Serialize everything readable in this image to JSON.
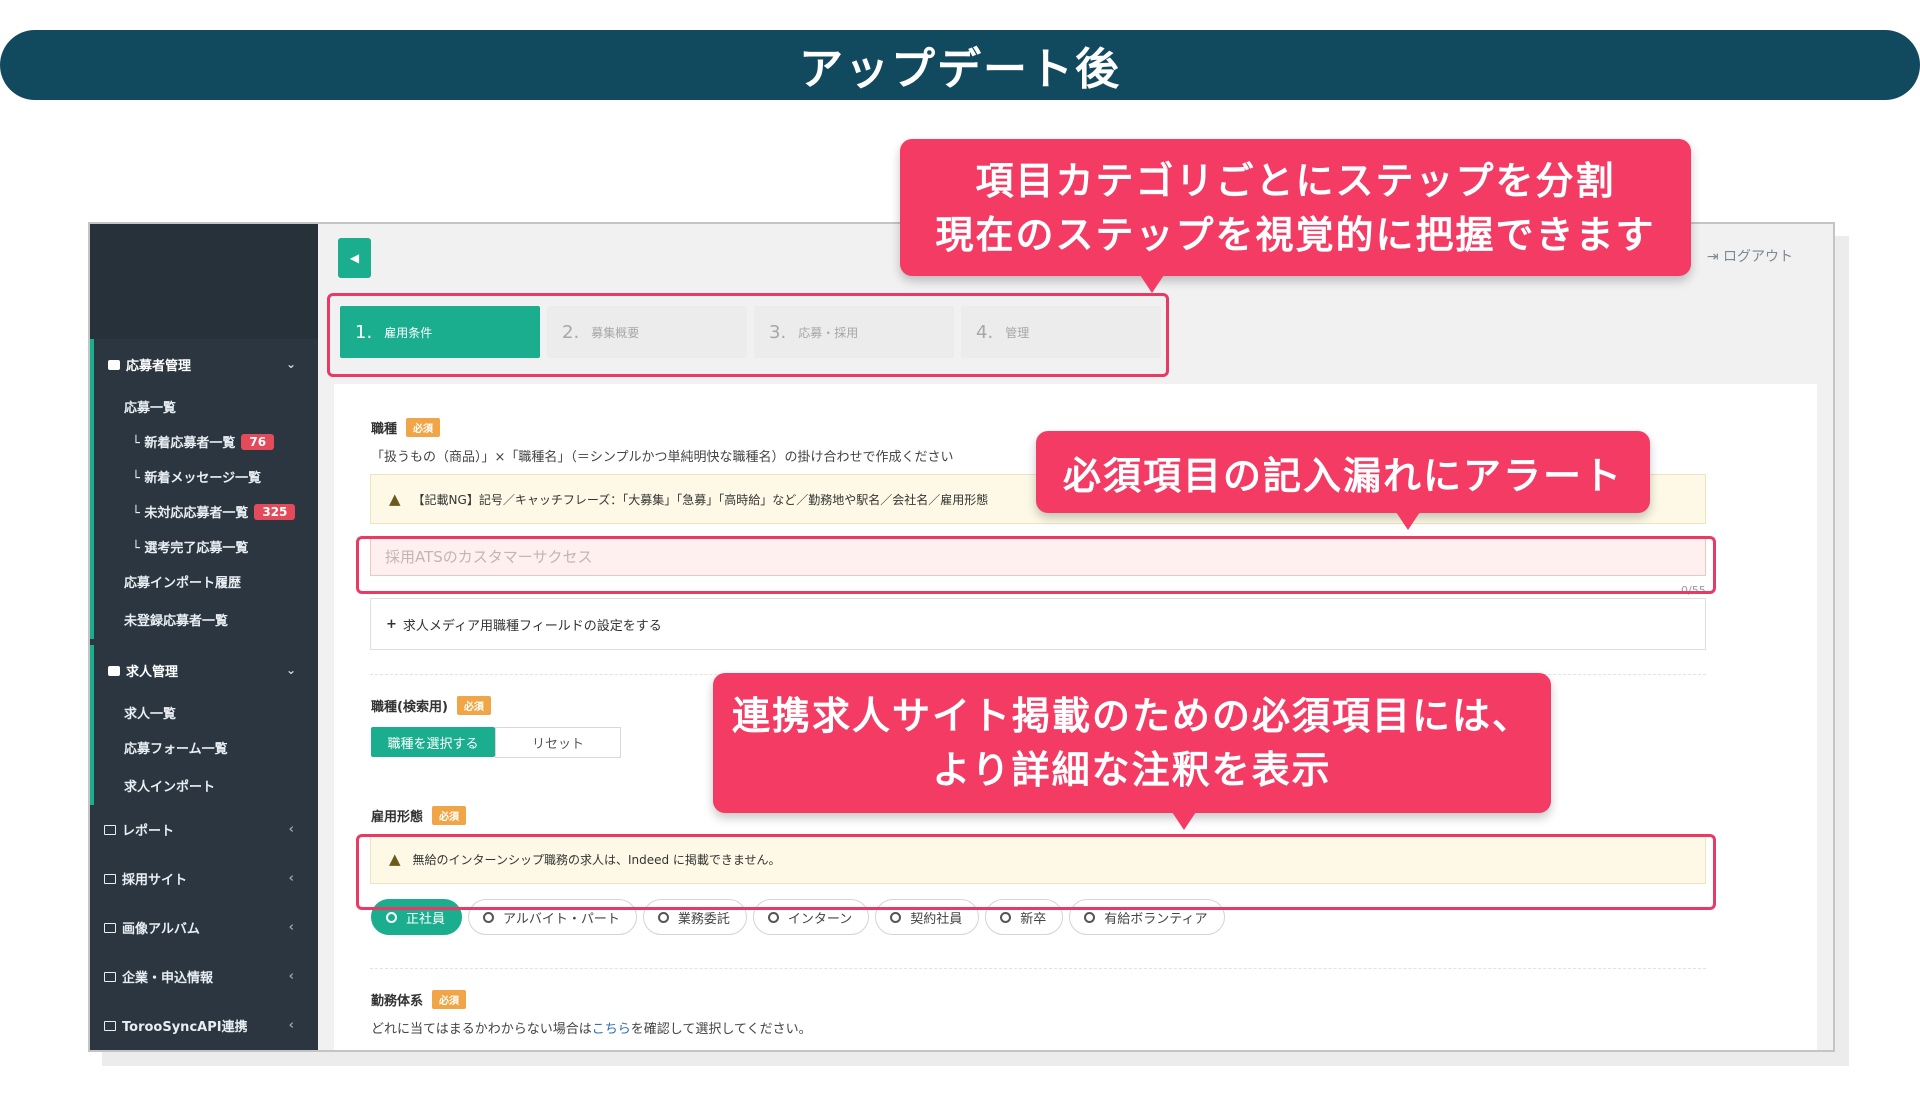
{
  "banner": {
    "title": "アップデート後"
  },
  "sidebar": {
    "group1": {
      "title": "応募者管理",
      "items": [
        {
          "label": "応募一覧",
          "badge": ""
        },
        {
          "label": "└ 新着応募者一覧",
          "badge": "76"
        },
        {
          "label": "└ 新着メッセージ一覧",
          "badge": ""
        },
        {
          "label": "└ 未対応応募者一覧",
          "badge": "325"
        },
        {
          "label": "└ 選考完了応募一覧",
          "badge": ""
        },
        {
          "label": "応募インポート履歴",
          "badge": ""
        },
        {
          "label": "未登録応募者一覧",
          "badge": ""
        }
      ]
    },
    "group2": {
      "title": "求人管理",
      "items": [
        {
          "label": "求人一覧"
        },
        {
          "label": "応募フォーム一覧"
        },
        {
          "label": "求人インポート"
        }
      ]
    },
    "links": [
      {
        "label": "レポート"
      },
      {
        "label": "採用サイト"
      },
      {
        "label": "画像アルバム"
      },
      {
        "label": "企業・申込情報"
      },
      {
        "label": "TorooSyncAPI連携"
      }
    ]
  },
  "header": {
    "logout": "ログアウト"
  },
  "steps": [
    {
      "num": "1.",
      "label": "雇用条件"
    },
    {
      "num": "2.",
      "label": "募集概要"
    },
    {
      "num": "3.",
      "label": "応募・採用"
    },
    {
      "num": "4.",
      "label": "管理"
    }
  ],
  "form": {
    "required_tag": "必須",
    "job_type": {
      "label": "職種",
      "help": "「扱うもの（商品）」×「職種名」（＝シンプルかつ単純明快な職種名）の掛け合わせで作成ください",
      "warning": "【記載NG】記号／キャッチフレーズ：「大募集」「急募」「高時給」など／勤務地や駅名／会社名／雇用形態",
      "placeholder": "採用ATSのカスタマーサクセス",
      "counter": "0/55",
      "media_field": "求人メディア用職種フィールドの設定をする"
    },
    "job_search": {
      "label": "職種(検索用)",
      "select_button": "職種を選択する",
      "reset_button": "リセット"
    },
    "employment": {
      "label": "雇用形態",
      "warning": "無給のインターンシップ職務の求人は、Indeed に掲載できません。",
      "options": [
        "正社員",
        "アルバイト・パート",
        "業務委託",
        "インターン",
        "契約社員",
        "新卒",
        "有給ボランティア"
      ],
      "selected": "正社員"
    },
    "work_system": {
      "label": "勤務体系",
      "help_pre": "どれに当てはまるかわからない場合は",
      "help_link": "こちら",
      "help_post": "を確認して選択してください。"
    }
  },
  "callouts": {
    "steps_line1": "項目カテゴリごとにステップを分割",
    "steps_line2": "現在のステップを視覚的に把握できます",
    "alert": "必須項目の記入漏れにアラート",
    "notes_line1": "連携求人サイト掲載のための必須項目には、",
    "notes_line2": "より詳細な注釈を表示"
  },
  "colors": {
    "banner": "#114a5e",
    "accent": "#1aae8e",
    "callout": "#f33b63",
    "sidebar": "#2b3640",
    "required": "#f0a646"
  }
}
